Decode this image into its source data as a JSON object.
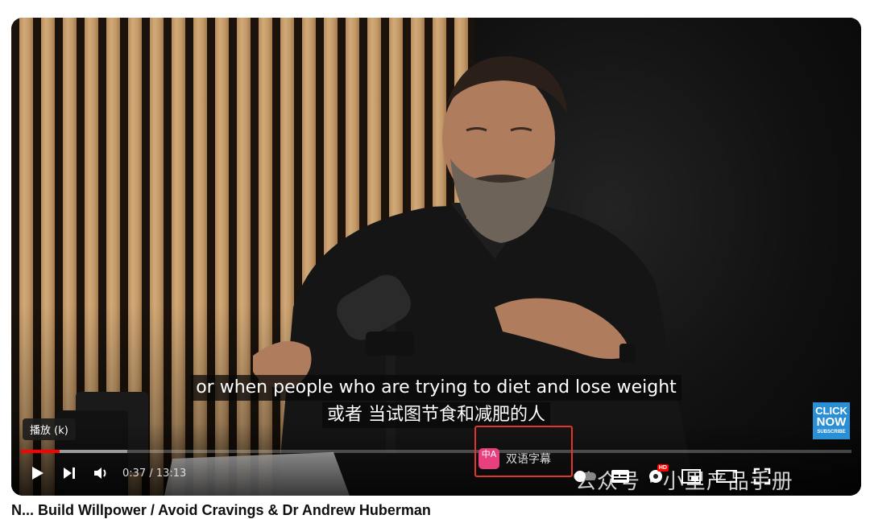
{
  "subtitles": {
    "english": "or when people who are trying to diet and lose weight",
    "chinese": "或者 当试图节食和减肥的人"
  },
  "tooltip": "播放 (k)",
  "badge": {
    "line1": "CLICK",
    "line2": "NOW",
    "line3": "SUBSCRIBE",
    "color": "#2b8fd6"
  },
  "player": {
    "time": "0:37 / 13:13",
    "progress_played_fraction": 0.047,
    "progress_loaded_fraction": 0.128,
    "accent": "#ff0000"
  },
  "bilingual": {
    "icon_text": "中A",
    "label": "双语字幕"
  },
  "settings": {
    "hd_label": "HD"
  },
  "watermark": "公众号 · 小里产品手册",
  "video_title_partial": "N... Build Willpower / Avoid Cravings & Dr Andrew Huberman"
}
